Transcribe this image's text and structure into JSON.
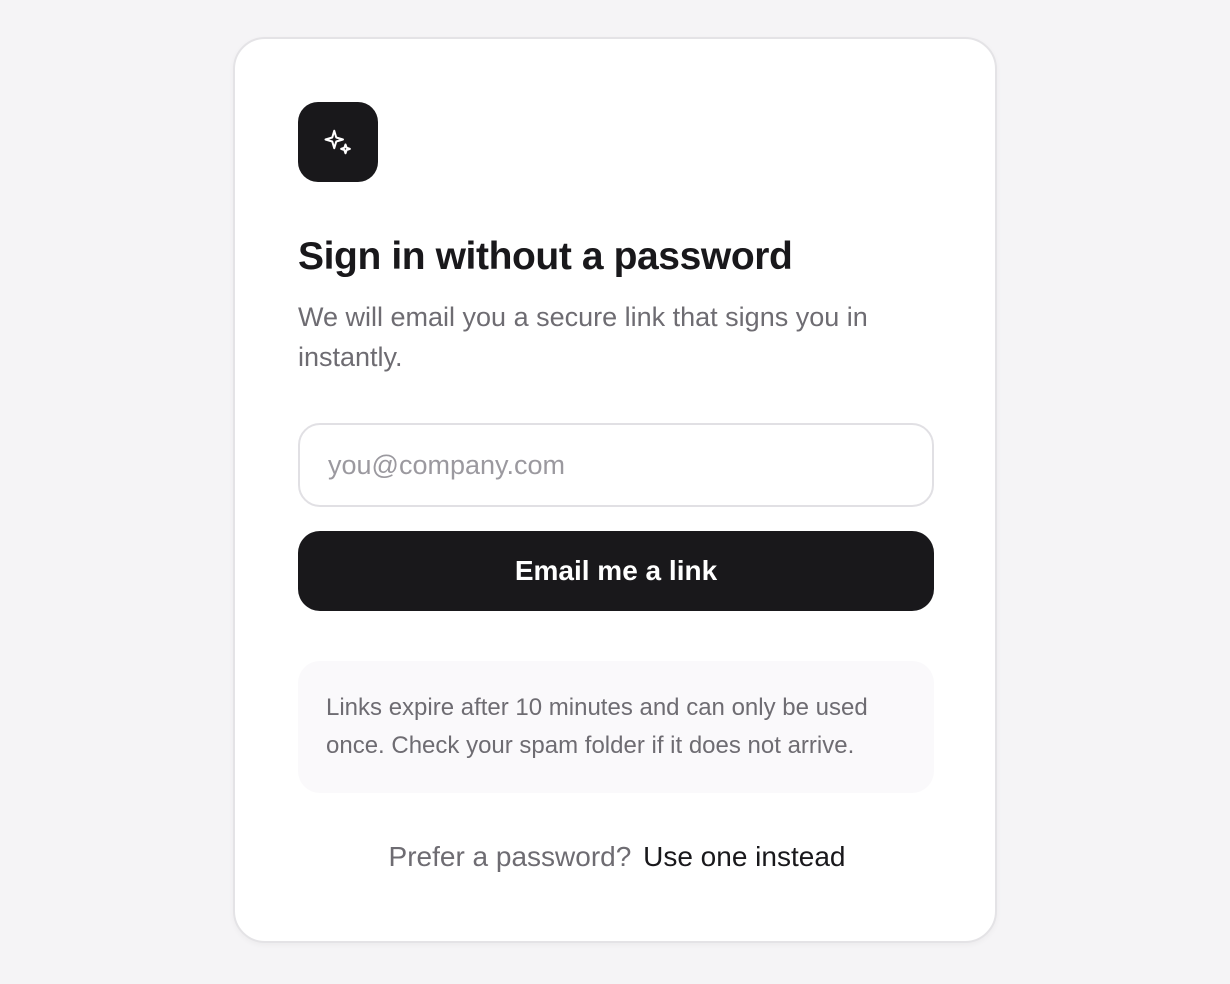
{
  "logo": {
    "icon": "sparkles-icon",
    "background": "#19181b"
  },
  "heading": {
    "title": "Sign in without a password",
    "subtitle": "We will email you a secure link that signs you in instantly."
  },
  "form": {
    "email_value": "",
    "email_placeholder": "you@company.com",
    "submit_label": "Email me a link"
  },
  "notice": {
    "text": "Links expire after 10 minutes and can only be used once. Check your spam folder if it does not arrive."
  },
  "footer": {
    "prompt": "Prefer a password?",
    "link_label": "Use one instead"
  },
  "colors": {
    "page_background": "#f5f4f6",
    "primary": "#19181b",
    "muted_text": "#6e6c72"
  }
}
